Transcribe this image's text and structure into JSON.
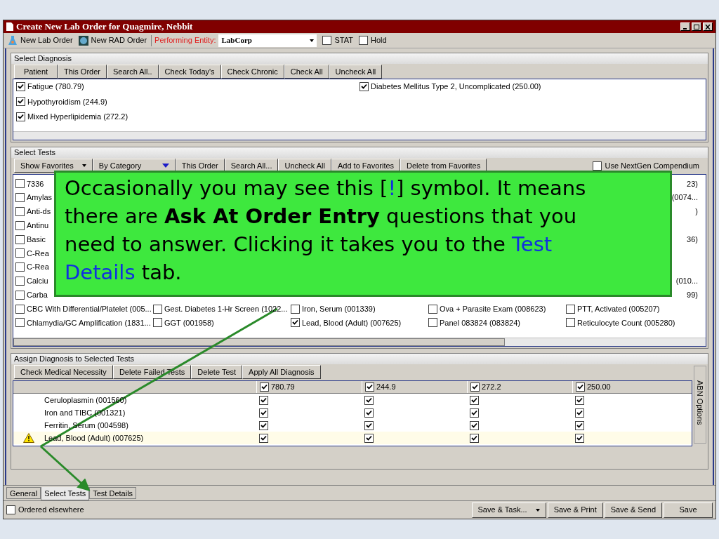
{
  "window": {
    "title": "Create New Lab Order for Quagmire, Nebbit"
  },
  "toolbar": {
    "buttons": [
      {
        "label": "New Lab Order",
        "kind": "lab"
      },
      {
        "label": "New RAD Order",
        "kind": "rad"
      }
    ],
    "entity_label": "Performing Entity:",
    "entity_value": "LabCorp",
    "options": [
      {
        "label": "STAT",
        "checked": false
      },
      {
        "label": "Hold",
        "checked": false
      }
    ]
  },
  "diagnosis": {
    "title": "Select Diagnosis",
    "buttons": [
      "Patient",
      "This Order",
      "Search All..",
      "Check Today's",
      "Check Chronic",
      "Check All",
      "Uncheck All"
    ],
    "columns": [
      [
        {
          "label": "Fatigue (780.79)",
          "checked": true
        },
        {
          "label": "Hypothyroidism (244.9)",
          "checked": true
        },
        {
          "label": "Mixed Hyperlipidemia (272.2)",
          "checked": true
        }
      ],
      [
        {
          "label": "Diabetes Mellitus Type 2, Uncomplicated (250.00)",
          "checked": true
        }
      ]
    ]
  },
  "tests": {
    "title": "Select Tests",
    "buttons": [
      {
        "label": "Show Favorites",
        "kind": "split"
      },
      {
        "label": "By Category",
        "kind": "dropdown"
      },
      {
        "label": "This Order",
        "kind": "plain"
      },
      {
        "label": "Search All...",
        "kind": "plain"
      },
      {
        "label": "Uncheck All",
        "kind": "plain"
      },
      {
        "label": "Add to Favorites",
        "kind": "plain"
      },
      {
        "label": "Delete from Favorites",
        "kind": "plain"
      }
    ],
    "compendium": {
      "label": "Use NextGen Compendium",
      "checked": false
    },
    "rows": [
      [
        {
          "kind": "item",
          "text": "7336",
          "checked": false
        },
        null,
        null,
        null,
        {
          "kind": "tail",
          "text": "23)"
        }
      ],
      [
        {
          "kind": "item",
          "text": "Amylas",
          "checked": false
        },
        null,
        null,
        null,
        {
          "kind": "tail",
          "text": "(0074..."
        }
      ],
      [
        {
          "kind": "item",
          "text": "Anti-ds",
          "checked": false
        },
        null,
        null,
        null,
        {
          "kind": "tail",
          "text": ")"
        }
      ],
      [
        {
          "kind": "item",
          "text": "Antinu",
          "checked": false
        },
        null,
        null,
        null,
        null
      ],
      [
        {
          "kind": "item",
          "text": "Basic",
          "checked": false
        },
        null,
        null,
        null,
        {
          "kind": "tail",
          "text": "36)"
        }
      ],
      [
        {
          "kind": "item",
          "text": "C-Rea",
          "checked": false
        },
        null,
        null,
        null,
        null
      ],
      [
        {
          "kind": "item",
          "text": "C-Rea",
          "checked": false
        },
        null,
        null,
        null,
        null
      ],
      [
        {
          "kind": "item",
          "text": "Calciu",
          "checked": false
        },
        null,
        null,
        null,
        {
          "kind": "tail",
          "text": "(010..."
        }
      ],
      [
        {
          "kind": "item",
          "text": "Carba",
          "checked": false
        },
        null,
        null,
        null,
        {
          "kind": "tail",
          "text": "99)"
        }
      ],
      [
        {
          "kind": "item",
          "text": "CBC With Differential/Platelet (005...",
          "checked": false
        },
        {
          "kind": "item",
          "text": "Gest. Diabetes 1-Hr Screen (1022...",
          "checked": false
        },
        {
          "kind": "item",
          "text": "Iron, Serum (001339)",
          "checked": false
        },
        {
          "kind": "item",
          "text": "Ova + Parasite Exam (008623)",
          "checked": false
        },
        {
          "kind": "item",
          "text": "PTT, Activated (005207)",
          "checked": false
        }
      ],
      [
        {
          "kind": "item",
          "text": "Chlamydia/GC Amplification (1831...",
          "checked": false
        },
        {
          "kind": "item",
          "text": "GGT (001958)",
          "checked": false
        },
        {
          "kind": "item",
          "text": "Lead, Blood (Adult) (007625)",
          "checked": true
        },
        {
          "kind": "item",
          "text": "Panel 083824 (083824)",
          "checked": false
        },
        {
          "kind": "item",
          "text": "Reticulocyte Count (005280)",
          "checked": false
        }
      ]
    ]
  },
  "callout": {
    "segments": [
      {
        "kind": "plain",
        "text": "Occasionally you may see this ["
      },
      {
        "kind": "blue",
        "text": "!"
      },
      {
        "kind": "plain",
        "text": "] symbol.  It means there are "
      },
      {
        "kind": "bold",
        "text": "Ask At Order Entry"
      },
      {
        "kind": "plain",
        "text": " questions that you need to answer.  Clicking it takes you to the "
      },
      {
        "kind": "blue",
        "text": "Test Details"
      },
      {
        "kind": "plain",
        "text": " tab."
      }
    ]
  },
  "assign": {
    "title": "Assign Diagnosis to Selected Tests",
    "buttons": [
      "Check Medical Necessity",
      "Delete Failed Tests",
      "Delete Test",
      "Apply All Diagnosis"
    ],
    "columns": [
      {
        "code": "780.79",
        "checked": true
      },
      {
        "code": "244.9",
        "checked": true
      },
      {
        "code": "272.2",
        "checked": true
      },
      {
        "code": "250.00",
        "checked": true
      }
    ],
    "rows": [
      {
        "name": "Ceruloplasmin (001560)",
        "warning": false,
        "checks": [
          true,
          true,
          true,
          true
        ]
      },
      {
        "name": "Iron and TIBC (001321)",
        "warning": false,
        "checks": [
          true,
          true,
          true,
          true
        ]
      },
      {
        "name": "Ferritin, Serum (004598)",
        "warning": false,
        "checks": [
          true,
          true,
          true,
          true
        ]
      },
      {
        "name": "Lead, Blood (Adult) (007625)",
        "warning": true,
        "checks": [
          true,
          true,
          true,
          true
        ]
      }
    ],
    "side_label": "ABN Options"
  },
  "tabs": [
    {
      "label": "General",
      "selected": false
    },
    {
      "label": "Select Tests",
      "selected": true
    },
    {
      "label": "Test Details",
      "selected": false
    }
  ],
  "footer": {
    "ordered_elsewhere": {
      "label": "Ordered elsewhere",
      "checked": false
    },
    "buttons": [
      {
        "label": "Save & Task...",
        "kind": "split"
      },
      {
        "label": "Save & Print",
        "kind": "plain"
      },
      {
        "label": "Save & Send",
        "kind": "plain"
      },
      {
        "label": "Save",
        "kind": "plain"
      }
    ]
  }
}
